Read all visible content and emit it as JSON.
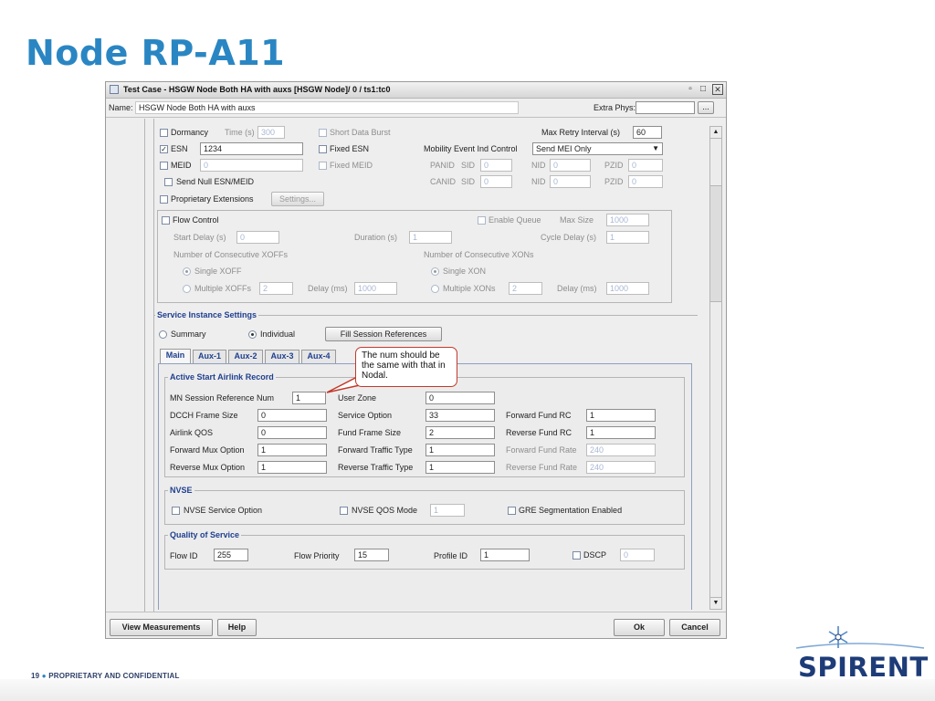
{
  "slide": {
    "title": "Node RP-A11",
    "page_number": "19",
    "footer": "PROPRIETARY AND CONFIDENTIAL",
    "logo_text": "SPIRENT"
  },
  "window": {
    "title": "Test Case - HSGW Node Both HA with auxs [HSGW Node]/ 0 / ts1:tc0",
    "name_label": "Name:",
    "name_value": "HSGW Node Both HA with auxs",
    "extra_phys_label": "Extra Phys:",
    "extra_phys_value": "",
    "browse_label": "..."
  },
  "top": {
    "dormancy": {
      "label": "Dormancy",
      "checked": false
    },
    "time_label": "Time (s)",
    "time_value": "300",
    "short_data_burst": "Short Data Burst",
    "max_retry_label": "Max Retry Interval (s)",
    "max_retry_value": "60",
    "esn": {
      "label": "ESN",
      "checked": true,
      "value": "1234"
    },
    "fixed_esn": "Fixed ESN",
    "mobility_label": "Mobility Event Ind Control",
    "mobility_value": "Send MEI Only",
    "meid": {
      "label": "MEID",
      "value": "0"
    },
    "fixed_meid": "Fixed MEID",
    "panid_label": "PANID",
    "canid_label": "CANID",
    "sid_label": "SID",
    "nid_label": "NID",
    "pzid_label": "PZID",
    "panid_sid": "0",
    "panid_nid": "0",
    "panid_pzid": "0",
    "canid_sid": "0",
    "canid_nid": "0",
    "canid_pzid": "0",
    "send_null": "Send Null ESN/MEID",
    "proprietary": "Proprietary Extensions",
    "settings_btn": "Settings..."
  },
  "flow": {
    "flow_control": "Flow Control",
    "enable_queue": "Enable Queue",
    "max_size_label": "Max Size",
    "max_size_value": "1000",
    "start_delay_label": "Start Delay (s)",
    "start_delay_value": "0",
    "duration_label": "Duration (s)",
    "duration_value": "1",
    "cycle_delay_label": "Cycle Delay (s)",
    "cycle_delay_value": "1",
    "xoffs_label": "Number of Consecutive XOFFs",
    "xons_label": "Number of Consecutive XONs",
    "single_xoff": "Single XOFF",
    "single_xon": "Single XON",
    "multiple_xoffs": "Multiple XOFFs",
    "multiple_xoffs_value": "2",
    "multiple_xons": "Multiple XONs",
    "multiple_xons_value": "2",
    "delay_ms_label": "Delay (ms)",
    "delay_ms_xoff": "1000",
    "delay_ms_xon": "1000"
  },
  "service": {
    "title": "Service Instance Settings",
    "summary": "Summary",
    "individual": "Individual",
    "fill_btn": "Fill Session References",
    "tabs": [
      "Main",
      "Aux-1",
      "Aux-2",
      "Aux-3",
      "Aux-4"
    ],
    "callout": "The num should be the same with that in Nodal."
  },
  "airlink": {
    "title": "Active Start Airlink Record",
    "mn_label": "MN Session Reference Num",
    "mn_value": "1",
    "user_zone_label": "User Zone",
    "user_zone_value": "0",
    "dcch_label": "DCCH Frame Size",
    "dcch_value": "0",
    "service_option_label": "Service Option",
    "service_option_value": "33",
    "fwd_fund_rc_label": "Forward Fund RC",
    "fwd_fund_rc_value": "1",
    "airlink_qos_label": "Airlink QOS",
    "airlink_qos_value": "0",
    "fund_frame_label": "Fund Frame Size",
    "fund_frame_value": "2",
    "rev_fund_rc_label": "Reverse Fund RC",
    "rev_fund_rc_value": "1",
    "fwd_mux_label": "Forward Mux Option",
    "fwd_mux_value": "1",
    "fwd_traffic_label": "Forward Traffic Type",
    "fwd_traffic_value": "1",
    "fwd_fund_rate_label": "Forward Fund Rate",
    "fwd_fund_rate_value": "240",
    "rev_mux_label": "Reverse Mux Option",
    "rev_mux_value": "1",
    "rev_traffic_label": "Reverse Traffic Type",
    "rev_traffic_value": "1",
    "rev_fund_rate_label": "Reverse Fund Rate",
    "rev_fund_rate_value": "240"
  },
  "nvse": {
    "title": "NVSE",
    "service_option": "NVSE Service Option",
    "qos_mode": "NVSE QOS Mode",
    "qos_value": "1",
    "gre": "GRE Segmentation Enabled"
  },
  "qos": {
    "title": "Quality of Service",
    "flow_id_label": "Flow ID",
    "flow_id_value": "255",
    "flow_priority_label": "Flow Priority",
    "flow_priority_value": "15",
    "profile_id_label": "Profile ID",
    "profile_id_value": "1",
    "dscp_label": "DSCP",
    "dscp_value": "0"
  },
  "buttons": {
    "view_measurements": "View Measurements",
    "help": "Help",
    "ok": "Ok",
    "cancel": "Cancel"
  },
  "colors": {
    "title_blue": "#2a86c3",
    "group_title": "#1f3f8f",
    "callout_border": "#c0392b",
    "logo_navy": "#1d3c78"
  }
}
